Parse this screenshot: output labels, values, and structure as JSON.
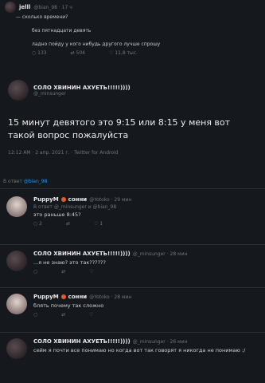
{
  "quoted": {
    "name": "jelll",
    "handle": "@bian_98 · 17 ч",
    "lines": [
      "— сколько времени?",
      "без пятнадцати девять",
      "ладно пойду у кого нибудь другого лучше спрошу"
    ],
    "actions": [
      "133",
      "504",
      "11,8 тыс."
    ]
  },
  "main": {
    "name": "СОЛО ХВИНИН АХУЕТЬ!!!!!))))",
    "handle": "@_minsunger",
    "reply_to_prefix": "В ответ",
    "reply_to_handle": "@bian_98",
    "text": "15 минут девятого это 9:15 или 8:15 у меня вот такой вопрос пожалуйста",
    "meta": "12:12 AM · 2 апр. 2021 г. · Twitter for Android"
  },
  "replies": [
    {
      "name": "PuppyM",
      "badge": "сонни",
      "handle": "@Yotoko · 29 мин",
      "reply_line": "В ответ @_minsunger и @bian_98",
      "text": "это раньше 8:45?",
      "actions": [
        "2",
        "1"
      ]
    },
    {
      "name": "СОЛО ХВИНИН АХУЕТЬ!!!!!))))",
      "handle": "@_minsunger · 28 мин",
      "text": "...я не знаю? это так??????",
      "actions": [
        "",
        ""
      ]
    },
    {
      "name": "PuppyM",
      "badge": "сонни",
      "handle": "@Yotoko · 28 мин",
      "text": "блять почему так сложно",
      "actions": [
        "",
        ""
      ]
    },
    {
      "name": "СОЛО ХВИНИН АХУЕТЬ!!!!!))))",
      "handle": "@_minsunger · 26 мин",
      "text": "сейм я почти все понимаю но когда вот так говорят я никогда не понимаю :/",
      "actions": []
    }
  ],
  "colors": {
    "bg": "#15181c",
    "accent": "#1d9bf0",
    "text": "#d9d9d9",
    "muted": "#6e767d"
  }
}
